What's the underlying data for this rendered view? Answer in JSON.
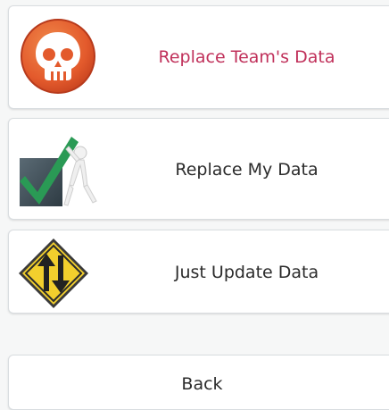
{
  "options": [
    {
      "label": "Replace Team's Data",
      "icon": "skull-icon"
    },
    {
      "label": "Replace My Data",
      "icon": "checkmark-figure-icon"
    },
    {
      "label": "Just Update Data",
      "icon": "up-down-arrows-sign-icon"
    }
  ],
  "back": {
    "label": "Back"
  },
  "colors": {
    "danger_label": "#c0305a",
    "skull_fill": "#e35a2c",
    "check": "#2a9a55",
    "sign": "#f2cf2d"
  }
}
